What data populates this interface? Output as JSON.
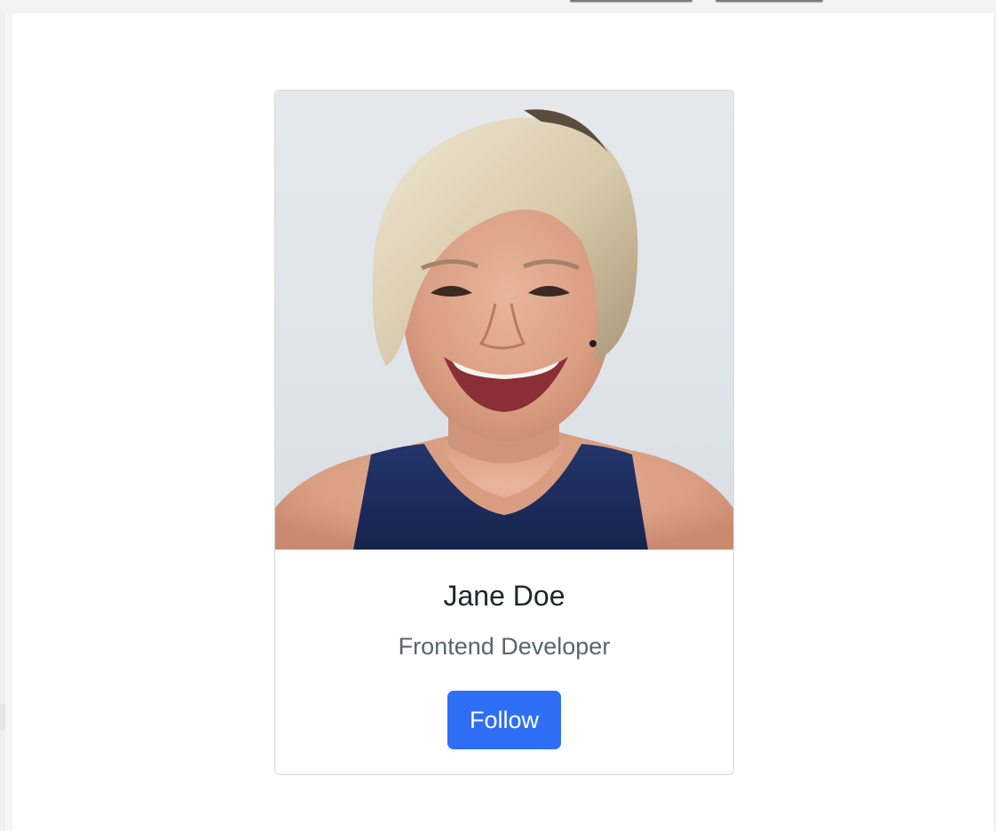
{
  "profile": {
    "name": "Jane Doe",
    "role": "Frontend Developer",
    "follow_label": "Follow",
    "photo_alt": "Portrait of Jane Doe"
  },
  "colors": {
    "accent": "#2f6ff5",
    "name_text": "#212529",
    "role_text": "#5c636a",
    "card_border": "#d7d7d7"
  }
}
